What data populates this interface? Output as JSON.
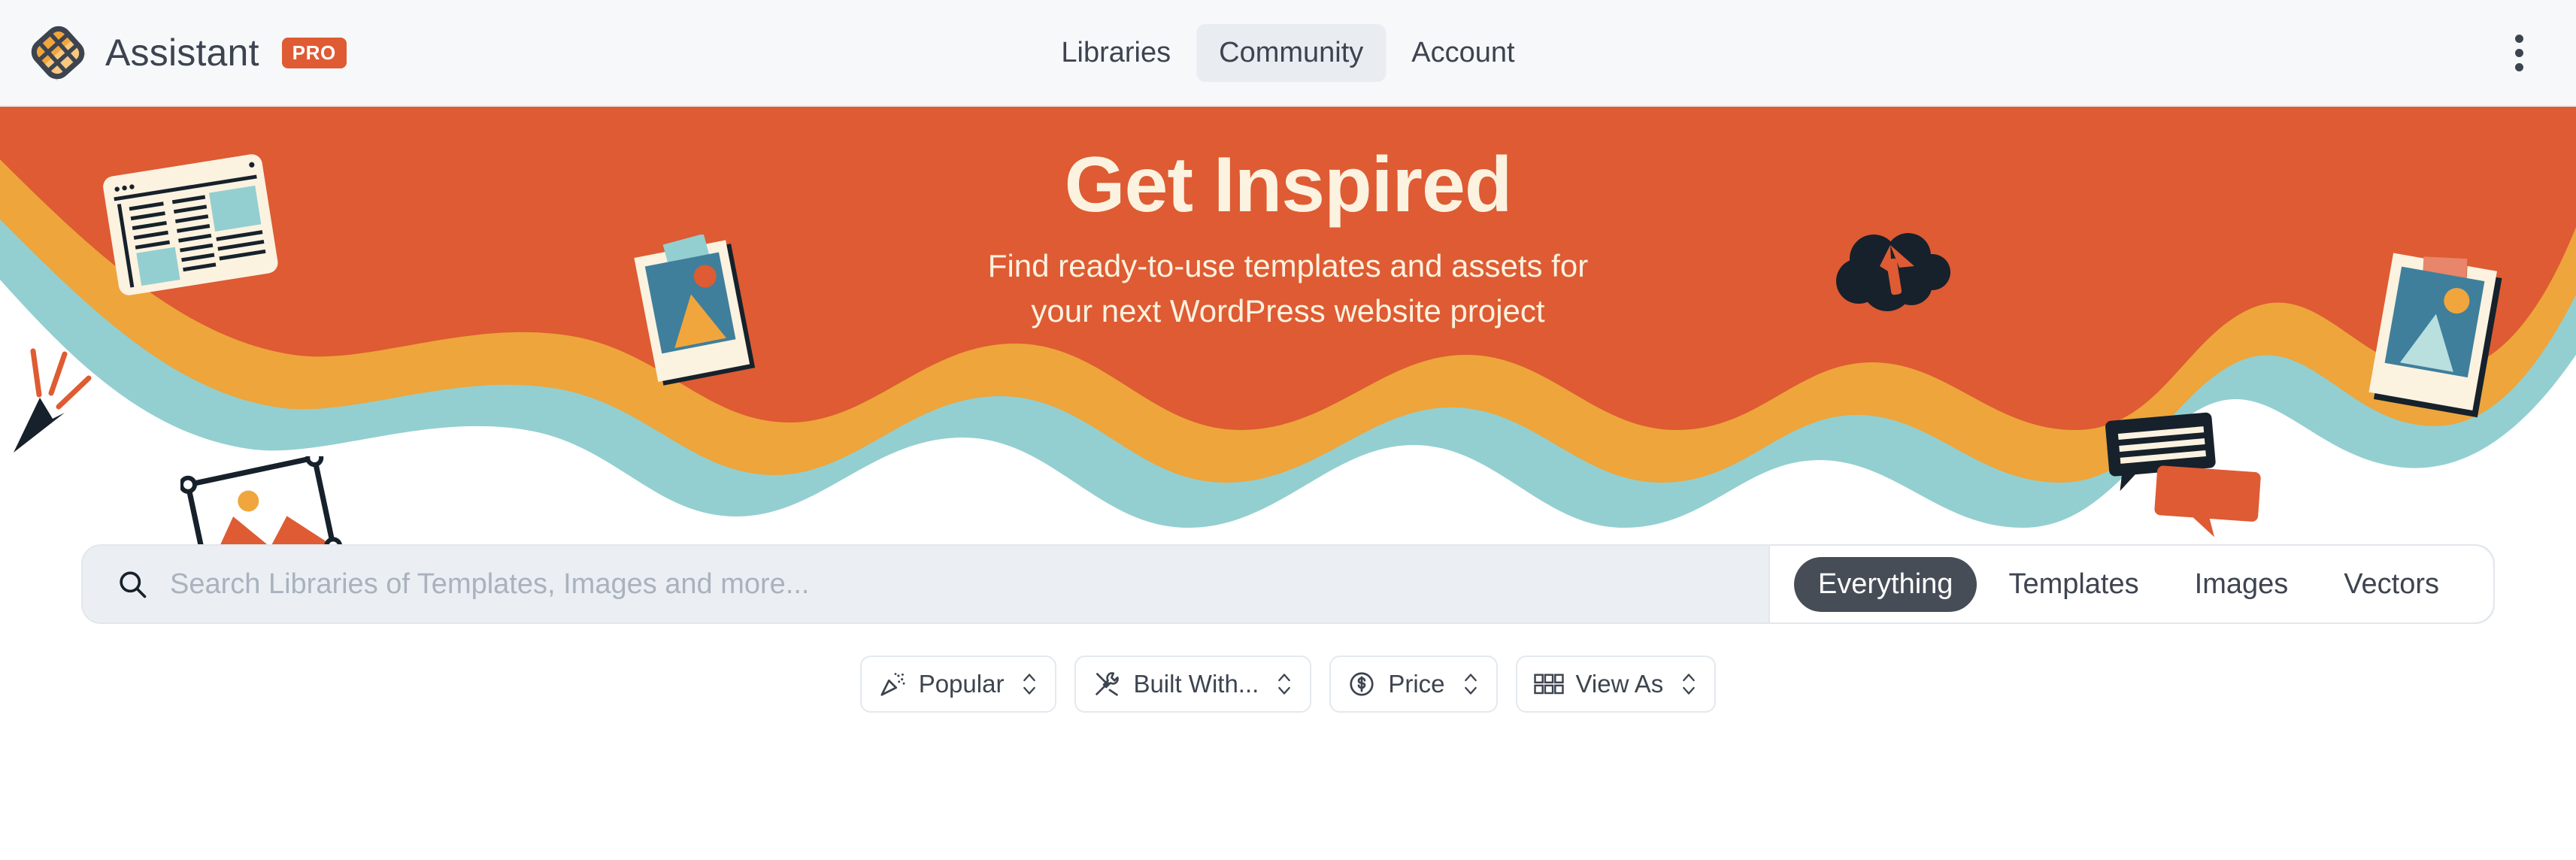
{
  "header": {
    "brand_name": "Assistant",
    "pro_badge": "PRO",
    "logo_icon": "waffle-logo-icon",
    "menu_icon": "kebab-menu-icon",
    "nav": [
      {
        "label": "Libraries",
        "active": false
      },
      {
        "label": "Community",
        "active": true
      },
      {
        "label": "Account",
        "active": false
      }
    ]
  },
  "hero": {
    "title": "Get Inspired",
    "subtitle_line1": "Find ready-to-use templates and assets for",
    "subtitle_line2": "your next WordPress website project",
    "decorations": [
      "browser-article-icon",
      "polaroid-photo-icon",
      "cursor-click-icon",
      "image-frame-selection-icon",
      "cloud-upload-icon",
      "speech-bubbles-icon",
      "polaroid-photo-right-icon"
    ]
  },
  "search": {
    "icon": "search-icon",
    "placeholder": "Search Libraries of Templates, Images and more...",
    "value": "",
    "tabs": [
      {
        "label": "Everything",
        "active": true
      },
      {
        "label": "Templates",
        "active": false
      },
      {
        "label": "Images",
        "active": false
      },
      {
        "label": "Vectors",
        "active": false
      }
    ]
  },
  "filters": [
    {
      "label": "Popular",
      "icon": "party-popper-icon"
    },
    {
      "label": "Built With...",
      "icon": "tools-icon"
    },
    {
      "label": "Price",
      "icon": "dollar-circle-icon"
    },
    {
      "label": "View As",
      "icon": "grid-view-icon"
    }
  ],
  "colors": {
    "brand_orange": "#de5b33",
    "accent_yellow": "#eda53c",
    "accent_teal": "#93cfd0",
    "cream": "#fbf2e0",
    "dark": "#3d4450",
    "header_bg": "#f6f8fa",
    "input_bg": "#ebeff3",
    "photo_blue": "#3f7f9b"
  }
}
